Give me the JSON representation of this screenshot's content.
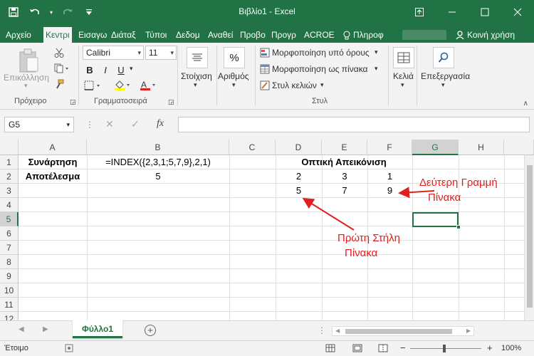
{
  "window": {
    "title": "Βιβλίο1 - Excel"
  },
  "ribbon_tabs": [
    {
      "label": "Αρχείο",
      "active": false
    },
    {
      "label": "Κεντρι",
      "active": true
    },
    {
      "label": "Εισαγω",
      "active": false
    },
    {
      "label": "Διάταξ",
      "active": false
    },
    {
      "label": "Τύποι",
      "active": false
    },
    {
      "label": "Δεδομ",
      "active": false
    },
    {
      "label": "Αναθεί",
      "active": false
    },
    {
      "label": "Προβο",
      "active": false
    },
    {
      "label": "Προγρ",
      "active": false
    },
    {
      "label": "ACROE",
      "active": false
    }
  ],
  "tell_me": "Πληροφ",
  "share": "Κοινή χρήση",
  "clipboard": {
    "paste": "Επικόλληση",
    "group": "Πρόχειρο"
  },
  "font": {
    "name": "Calibri",
    "size": "11",
    "group": "Γραμματοσειρά",
    "bold": "B",
    "italic": "I",
    "underline": "U"
  },
  "alignment": {
    "label": "Στοίχιση"
  },
  "number": {
    "label": "Αριθμός",
    "symbol": "%"
  },
  "styles": {
    "conditional": "Μορφοποίηση υπό όρους",
    "as_table": "Μορφοποίηση ως πίνακα",
    "cell_styles": "Στυλ κελιών",
    "group": "Στυλ"
  },
  "cells": {
    "label": "Κελιά"
  },
  "editing": {
    "label": "Επεξεργασία"
  },
  "formula_bar": {
    "name_box": "G5",
    "fx": "fx",
    "formula": ""
  },
  "columns": [
    "A",
    "B",
    "C",
    "D",
    "E",
    "F",
    "G",
    "H"
  ],
  "rows": [
    "1",
    "2",
    "3",
    "4",
    "5",
    "6",
    "7",
    "8",
    "9",
    "10",
    "11",
    "12"
  ],
  "sheet": {
    "A1": "Συνάρτηση",
    "B1": "=INDEX({2,3,1;5,7,9},2,1)",
    "A2": "Αποτέλεσμα",
    "B2": "5",
    "D1": "Οπτική Απεικόνιση",
    "D2": "2",
    "E2": "3",
    "F2": "1",
    "D3": "5",
    "E3": "7",
    "F3": "9"
  },
  "annotations": {
    "second_row": [
      "Δεύτερη Γραμμή",
      "Πίνακα"
    ],
    "first_col": [
      "Πρώτη Στήλη",
      "Πίνακα"
    ]
  },
  "sheet_tabs": [
    "Φύλλο1"
  ],
  "status": {
    "ready": "Έτοιμο",
    "zoom": "100%"
  },
  "colors": {
    "accent": "#217346",
    "annotation": "#e02020"
  }
}
